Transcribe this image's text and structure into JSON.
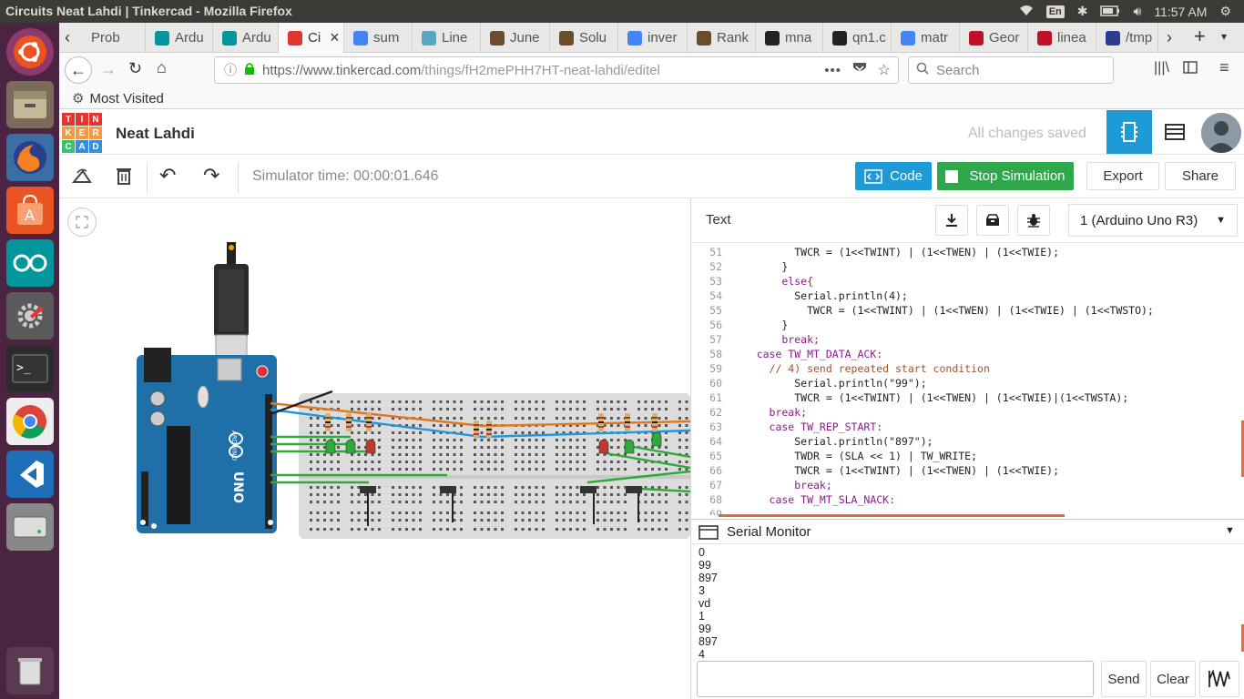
{
  "window": {
    "title": "Circuits Neat Lahdi | Tinkercad - Mozilla Firefox",
    "input_lang": "En",
    "clock": "11:57 AM"
  },
  "tabs": [
    {
      "label": "Prob",
      "icon": "tab-icon"
    },
    {
      "label": "Ardu",
      "icon": "arduino-icon"
    },
    {
      "label": "Ardu",
      "icon": "arduino-icon"
    },
    {
      "label": "Ci",
      "icon": "tinkercad-icon"
    },
    {
      "label": "sum",
      "icon": "google-icon"
    },
    {
      "label": "Line",
      "icon": "globe-icon"
    },
    {
      "label": "June",
      "icon": "cc-icon"
    },
    {
      "label": "Solu",
      "icon": "cc-icon"
    },
    {
      "label": "inver",
      "icon": "google-icon"
    },
    {
      "label": "Rank",
      "icon": "cc-icon"
    },
    {
      "label": "mna",
      "icon": "github-icon"
    },
    {
      "label": "qn1.c",
      "icon": "github-icon"
    },
    {
      "label": "matr",
      "icon": "google-icon"
    },
    {
      "label": "Geor",
      "icon": "bug-icon"
    },
    {
      "label": "linea",
      "icon": "bug-icon"
    },
    {
      "label": "/tmp",
      "icon": "folder-icon"
    }
  ],
  "nav": {
    "url_host": "https://www.tinkercad.com",
    "url_path": "/things/fH2mePHH7HT-neat-lahdi/editel",
    "search_placeholder": "Search",
    "most_visited": "Most Visited"
  },
  "tinkercad": {
    "logo_letters": [
      "T",
      "I",
      "N",
      "K",
      "E",
      "R",
      "C",
      "A",
      "D"
    ],
    "project_name": "Neat Lahdi",
    "save_status": "All changes saved",
    "sim_time": "Simulator time: 00:00:01.646",
    "code_label": "Code",
    "stop_label": "Stop Simulation",
    "export_label": "Export",
    "share_label": "Share",
    "colors": {
      "accent": "#1e9ad6",
      "stop": "#2ea84a"
    }
  },
  "panel": {
    "mode": "Text",
    "device": "1 (Arduino Uno R3)",
    "serial_title": "Serial Monitor",
    "serial_output": [
      "0",
      "99",
      "897",
      "3",
      "vd",
      "1",
      "99",
      "897",
      "4"
    ],
    "send_label": "Send",
    "clear_label": "Clear"
  },
  "code_lines": [
    {
      "n": "51",
      "t": "          TWCR = (1<<TWINT) | (1<<TWEN) | (1<<TWIE);",
      "c": ""
    },
    {
      "n": "52",
      "t": "        }",
      "c": ""
    },
    {
      "n": "53",
      "t": "        else{",
      "c": "kw"
    },
    {
      "n": "54",
      "t": "          Serial.println(4);",
      "c": ""
    },
    {
      "n": "55",
      "t": "            TWCR = (1<<TWINT) | (1<<TWEN) | (1<<TWIE) | (1<<TWSTO);",
      "c": ""
    },
    {
      "n": "56",
      "t": "        }",
      "c": ""
    },
    {
      "n": "57",
      "t": "        break;",
      "c": "kw"
    },
    {
      "n": "58",
      "t": "    case TW_MT_DATA_ACK:",
      "c": "kw"
    },
    {
      "n": "59",
      "t": "      // 4) send repeated start condition",
      "c": "cm"
    },
    {
      "n": "60",
      "t": "          Serial.println(\"99\");",
      "c": ""
    },
    {
      "n": "61",
      "t": "          TWCR = (1<<TWINT) | (1<<TWEN) | (1<<TWIE)|(1<<TWSTA);",
      "c": ""
    },
    {
      "n": "62",
      "t": "      break;",
      "c": "kw"
    },
    {
      "n": "63",
      "t": "      case TW_REP_START:",
      "c": "kw"
    },
    {
      "n": "64",
      "t": "          Serial.println(\"897\");",
      "c": ""
    },
    {
      "n": "65",
      "t": "          TWDR = (SLA << 1) | TW_WRITE;",
      "c": ""
    },
    {
      "n": "66",
      "t": "          TWCR = (1<<TWINT) | (1<<TWEN) | (1<<TWIE);",
      "c": ""
    },
    {
      "n": "67",
      "t": "          break;",
      "c": "kw"
    },
    {
      "n": "68",
      "t": "      case TW_MT_SLA_NACK:",
      "c": "kw"
    },
    {
      "n": "69",
      "t": "",
      "c": ""
    }
  ],
  "board": {
    "name": "UNO",
    "brand": "ARDUINO"
  }
}
